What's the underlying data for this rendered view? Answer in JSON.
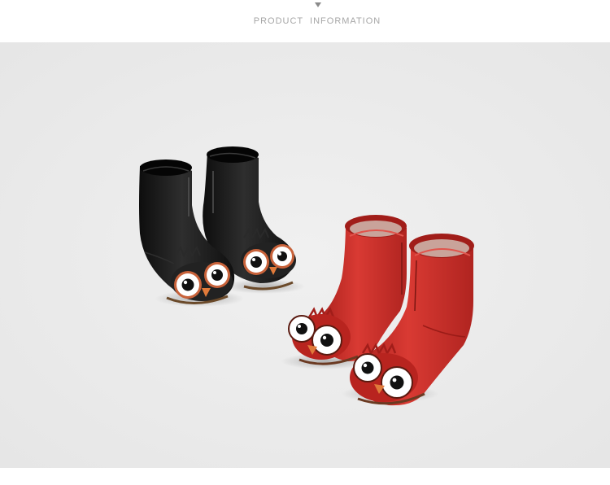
{
  "header": {
    "title": "PRODUCT  INFORMATION",
    "arrow_icon": "triangle-down-icon"
  },
  "photo": {
    "background_color": "#ececec",
    "subject": "two pairs of children's owl boots",
    "boot_colors": [
      "#1a1a1a",
      "#c42a25"
    ]
  }
}
